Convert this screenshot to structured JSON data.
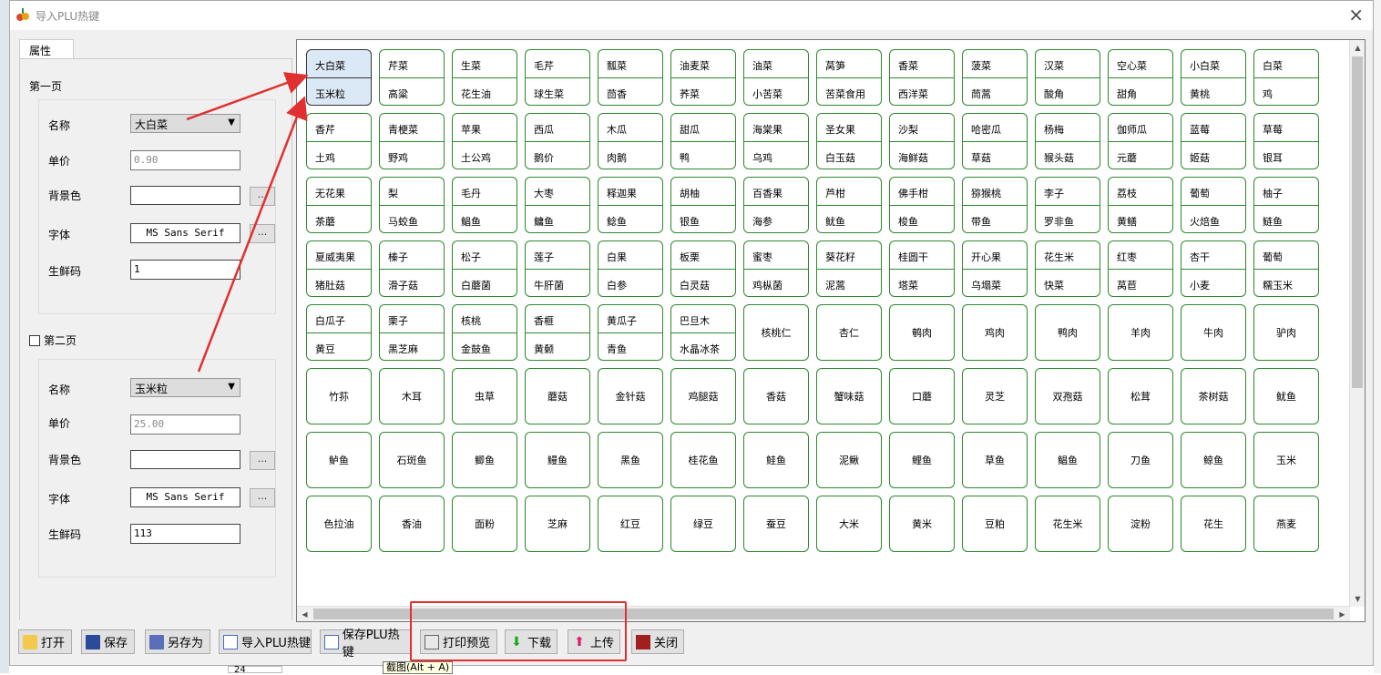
{
  "window": {
    "title": "导入PLU热键",
    "close_glyph": "×"
  },
  "tab": "属性",
  "page1": {
    "label": "第一页",
    "rows": {
      "name_label": "名称",
      "name_value": "大白菜",
      "price_label": "单价",
      "price_value": "0.90",
      "bg_label": "背景色",
      "bg_btn": "...",
      "font_label": "字体",
      "font_value": "MS Sans Serif",
      "font_btn": "...",
      "code_label": "生鲜码",
      "code_value": "1"
    }
  },
  "page2": {
    "label": "第二页",
    "checked": false,
    "rows": {
      "name_label": "名称",
      "name_value": "玉米粒",
      "price_label": "单价",
      "price_value": "25.00",
      "bg_label": "背景色",
      "bg_btn": "...",
      "font_label": "字体",
      "font_value": "MS Sans Serif",
      "font_btn": "...",
      "code_label": "生鲜码",
      "code_value": "113"
    }
  },
  "keys": [
    [
      "大白菜",
      "玉米粒"
    ],
    [
      "芹菜",
      "高粱"
    ],
    [
      "生菜",
      "花生油"
    ],
    [
      "毛芹",
      "球生菜"
    ],
    [
      "瓢菜",
      "茴香"
    ],
    [
      "油麦菜",
      "荞菜"
    ],
    [
      "油菜",
      "小苦菜"
    ],
    [
      "莴笋",
      "苦菜食用"
    ],
    [
      "香菜",
      "西洋菜"
    ],
    [
      "菠菜",
      "茼蒿"
    ],
    [
      "汉菜",
      "酸角"
    ],
    [
      "空心菜",
      "甜角"
    ],
    [
      "小白菜",
      "黄桃"
    ],
    [
      "白菜",
      "鸡"
    ],
    [
      "香芹",
      "土鸡"
    ],
    [
      "青梗菜",
      "野鸡"
    ],
    [
      "苹果",
      "土公鸡"
    ],
    [
      "西瓜",
      "鹅价"
    ],
    [
      "木瓜",
      "肉鹅"
    ],
    [
      "甜瓜",
      "鸭"
    ],
    [
      "海棠果",
      "乌鸡"
    ],
    [
      "圣女果",
      "白玉菇"
    ],
    [
      "沙梨",
      "海鲜菇"
    ],
    [
      "哈密瓜",
      "草菇"
    ],
    [
      "杨梅",
      "猴头菇"
    ],
    [
      "伽师瓜",
      "元蘑"
    ],
    [
      "蓝莓",
      "姬菇"
    ],
    [
      "草莓",
      "银耳"
    ],
    [
      "无花果",
      "茶蘑"
    ],
    [
      "梨",
      "马蛟鱼"
    ],
    [
      "毛丹",
      "鲳鱼"
    ],
    [
      "大枣",
      "鳙鱼"
    ],
    [
      "释迦果",
      "鲶鱼"
    ],
    [
      "胡柚",
      "银鱼"
    ],
    [
      "百香果",
      "海参"
    ],
    [
      "芦柑",
      "鱿鱼"
    ],
    [
      "佛手柑",
      "梭鱼"
    ],
    [
      "猕猴桃",
      "带鱼"
    ],
    [
      "李子",
      "罗非鱼"
    ],
    [
      "荔枝",
      "黄鳝"
    ],
    [
      "葡萄",
      "火焙鱼"
    ],
    [
      "柚子",
      "鲢鱼"
    ],
    [
      "夏威夷果",
      "猪肚菇"
    ],
    [
      "榛子",
      "滑子菇"
    ],
    [
      "松子",
      "白蘑菌"
    ],
    [
      "莲子",
      "牛肝菌"
    ],
    [
      "白果",
      "白参"
    ],
    [
      "板栗",
      "白灵菇"
    ],
    [
      "蜜枣",
      "鸡枞菌"
    ],
    [
      "葵花籽",
      "泥蒿"
    ],
    [
      "桂圆干",
      "塔菜"
    ],
    [
      "开心果",
      "乌塌菜"
    ],
    [
      "花生米",
      "快菜"
    ],
    [
      "红枣",
      "莴苣"
    ],
    [
      "杏干",
      "小麦"
    ],
    [
      "葡萄",
      "糯玉米"
    ],
    [
      "白瓜子",
      "黄豆"
    ],
    [
      "栗子",
      "黑芝麻"
    ],
    [
      "核桃",
      "金鼓鱼"
    ],
    [
      "香榧",
      "黄颡"
    ],
    [
      "黄瓜子",
      "青鱼"
    ],
    [
      "巴旦木",
      "水晶冰茶"
    ],
    [
      "核桃仁"
    ],
    [
      "杏仁"
    ],
    [
      "鹌肉"
    ],
    [
      "鸡肉"
    ],
    [
      "鸭肉"
    ],
    [
      "羊肉"
    ],
    [
      "牛肉"
    ],
    [
      "驴肉"
    ],
    [
      "竹荪"
    ],
    [
      "木耳"
    ],
    [
      "虫草"
    ],
    [
      "蘑菇"
    ],
    [
      "金针菇"
    ],
    [
      "鸡腿菇"
    ],
    [
      "香菇"
    ],
    [
      "蟹味菇"
    ],
    [
      "口蘑"
    ],
    [
      "灵芝"
    ],
    [
      "双孢菇"
    ],
    [
      "松茸"
    ],
    [
      "茶树菇"
    ],
    [
      "鱿鱼"
    ],
    [
      "鲈鱼"
    ],
    [
      "石斑鱼"
    ],
    [
      "鲫鱼"
    ],
    [
      "鳗鱼"
    ],
    [
      "黑鱼"
    ],
    [
      "桂花鱼"
    ],
    [
      "鲑鱼"
    ],
    [
      "泥鳅"
    ],
    [
      "鲤鱼"
    ],
    [
      "草鱼"
    ],
    [
      "鲳鱼"
    ],
    [
      "刀鱼"
    ],
    [
      "鲸鱼"
    ],
    [
      "玉米"
    ],
    [
      "色拉油"
    ],
    [
      "香油"
    ],
    [
      "面粉"
    ],
    [
      "芝麻"
    ],
    [
      "红豆"
    ],
    [
      "绿豆"
    ],
    [
      "蚕豆"
    ],
    [
      "大米"
    ],
    [
      "黄米"
    ],
    [
      "豆粕"
    ],
    [
      "花生米"
    ],
    [
      "淀粉"
    ],
    [
      "花生"
    ],
    [
      "燕麦"
    ]
  ],
  "scroll": {
    "up": "▲",
    "down": "▼",
    "left": "◀",
    "right": "▶"
  },
  "toolbar": {
    "open": "打开",
    "save": "保存",
    "save_as": "另存为",
    "import_plu": "导入PLU热键",
    "save_plu": "保存PLU热键",
    "print_preview": "打印预览",
    "download": "下载",
    "upload": "上传",
    "close": "关闭"
  },
  "tooltip": "截图(Alt + A)",
  "bg_fragment": "24",
  "annotation_color": "#e03030"
}
